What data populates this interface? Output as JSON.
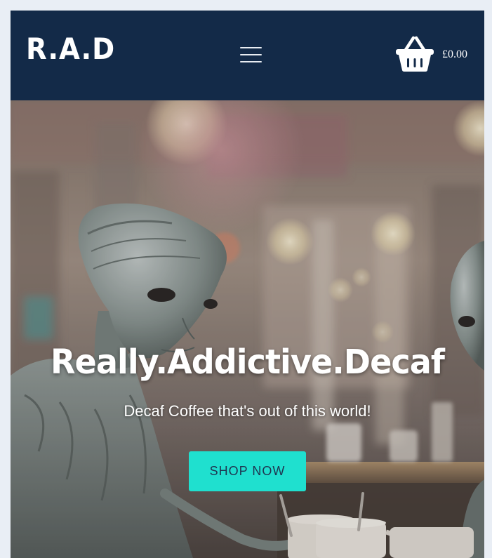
{
  "header": {
    "logo_text": "R.A.D",
    "menu_icon": "hamburger-menu-icon",
    "cart_icon": "shopping-basket-icon",
    "cart_total": "£0.00"
  },
  "hero": {
    "title": "Really.Addictive.Decaf",
    "subtitle": "Decaf Coffee that's out of this world!",
    "cta_label": "SHOP NOW",
    "background_image": "aliens-in-coffee-shop"
  },
  "colors": {
    "page_background": "#e9eef5",
    "navbar": "#132a48",
    "cta_button": "#1fe0cf",
    "cta_text": "#1f3550",
    "text_light": "#ffffff"
  }
}
